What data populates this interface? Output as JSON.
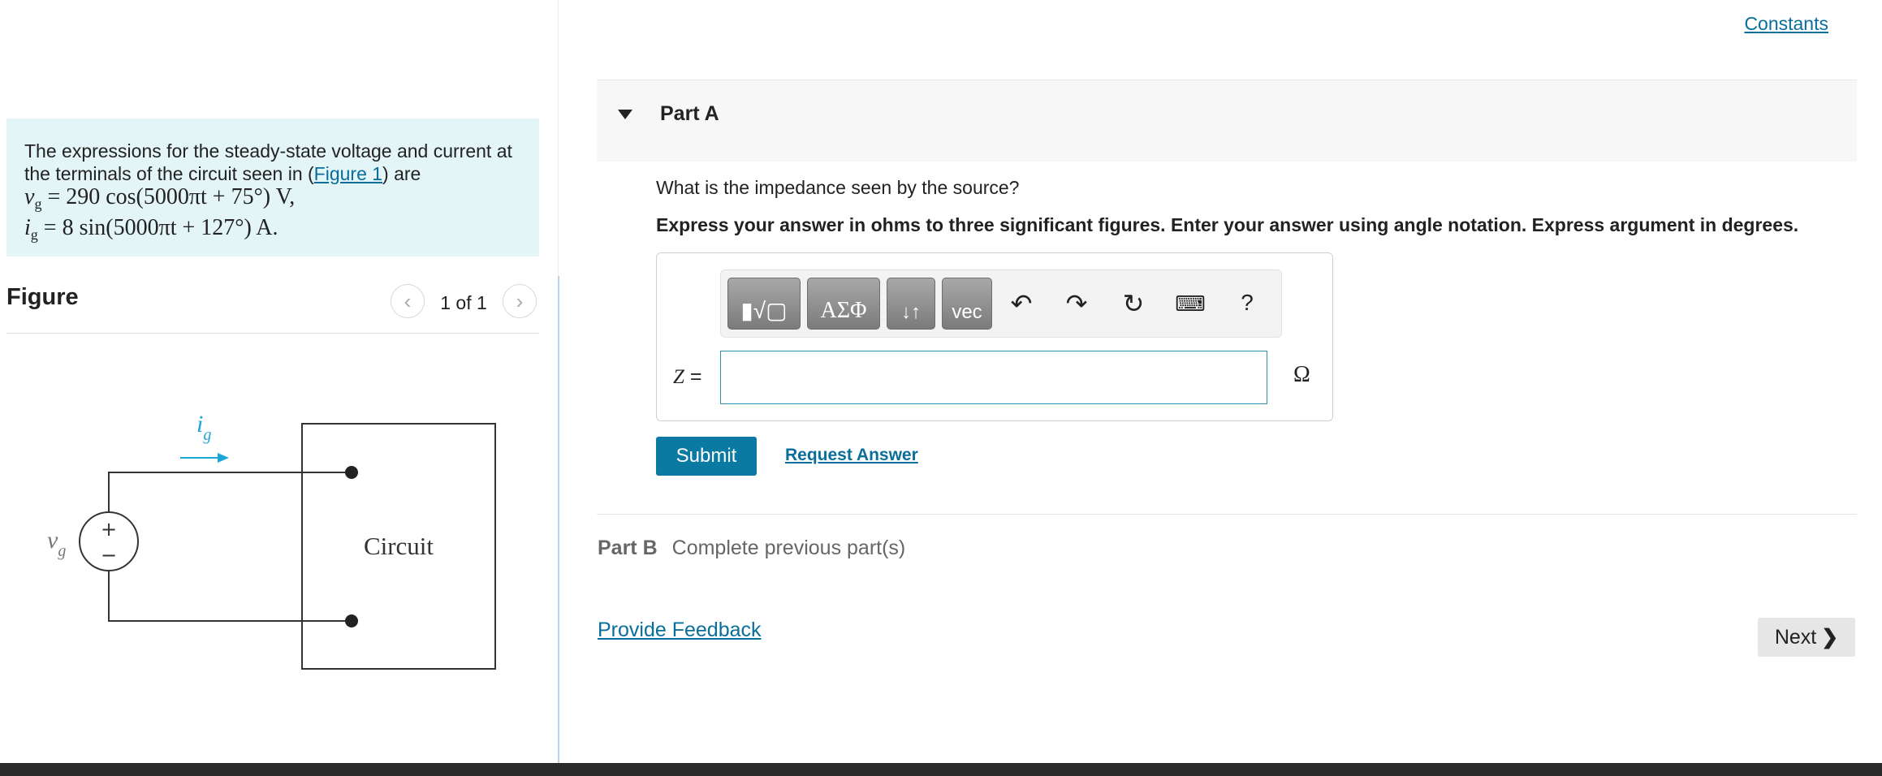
{
  "header": {
    "constants_label": "Constants"
  },
  "problem": {
    "text_before": "The expressions for the steady-state voltage and current at the terminals of the circuit seen in (",
    "figure_link": "Figure 1",
    "text_after": ") are",
    "eq_v_var": "v",
    "eq_v_sub": "g",
    "eq_v_rhs": " = 290 cos(5000πt + 75°) V,",
    "eq_i_var": "i",
    "eq_i_sub": "g",
    "eq_i_rhs": " =   8 sin(5000πt + 127°) A."
  },
  "figure": {
    "title": "Figure",
    "counter": "1 of 1",
    "prev_glyph": "‹",
    "next_glyph": "›",
    "current_label": "i",
    "current_sub": "g",
    "voltage_label": "v",
    "voltage_sub": "g",
    "plus": "+",
    "minus": "−",
    "box_label": "Circuit"
  },
  "part_a": {
    "title": "Part A",
    "question": "What is the impedance seen by the source?",
    "instructions": "Express your answer in ohms to three significant figures. Enter your answer using angle notation. Express argument in degrees.",
    "toolbar": {
      "templates_glyph": "▮√▢",
      "greek_glyph": "ΑΣΦ",
      "arrows_glyph": "↓↑",
      "vec_glyph": "vec",
      "help_glyph": "?"
    },
    "variable": "Z",
    "equals": "=",
    "input_value": "",
    "unit": "Ω",
    "submit_label": "Submit",
    "request_label": "Request Answer"
  },
  "part_b": {
    "label": "Part B",
    "status": "Complete previous part(s)"
  },
  "footer": {
    "feedback_label": "Provide Feedback",
    "next_label": "Next"
  },
  "colors": {
    "accent": "#0a7aa2",
    "problem_bg": "#e3f5f6",
    "current_arrow": "#1aa7d8"
  }
}
